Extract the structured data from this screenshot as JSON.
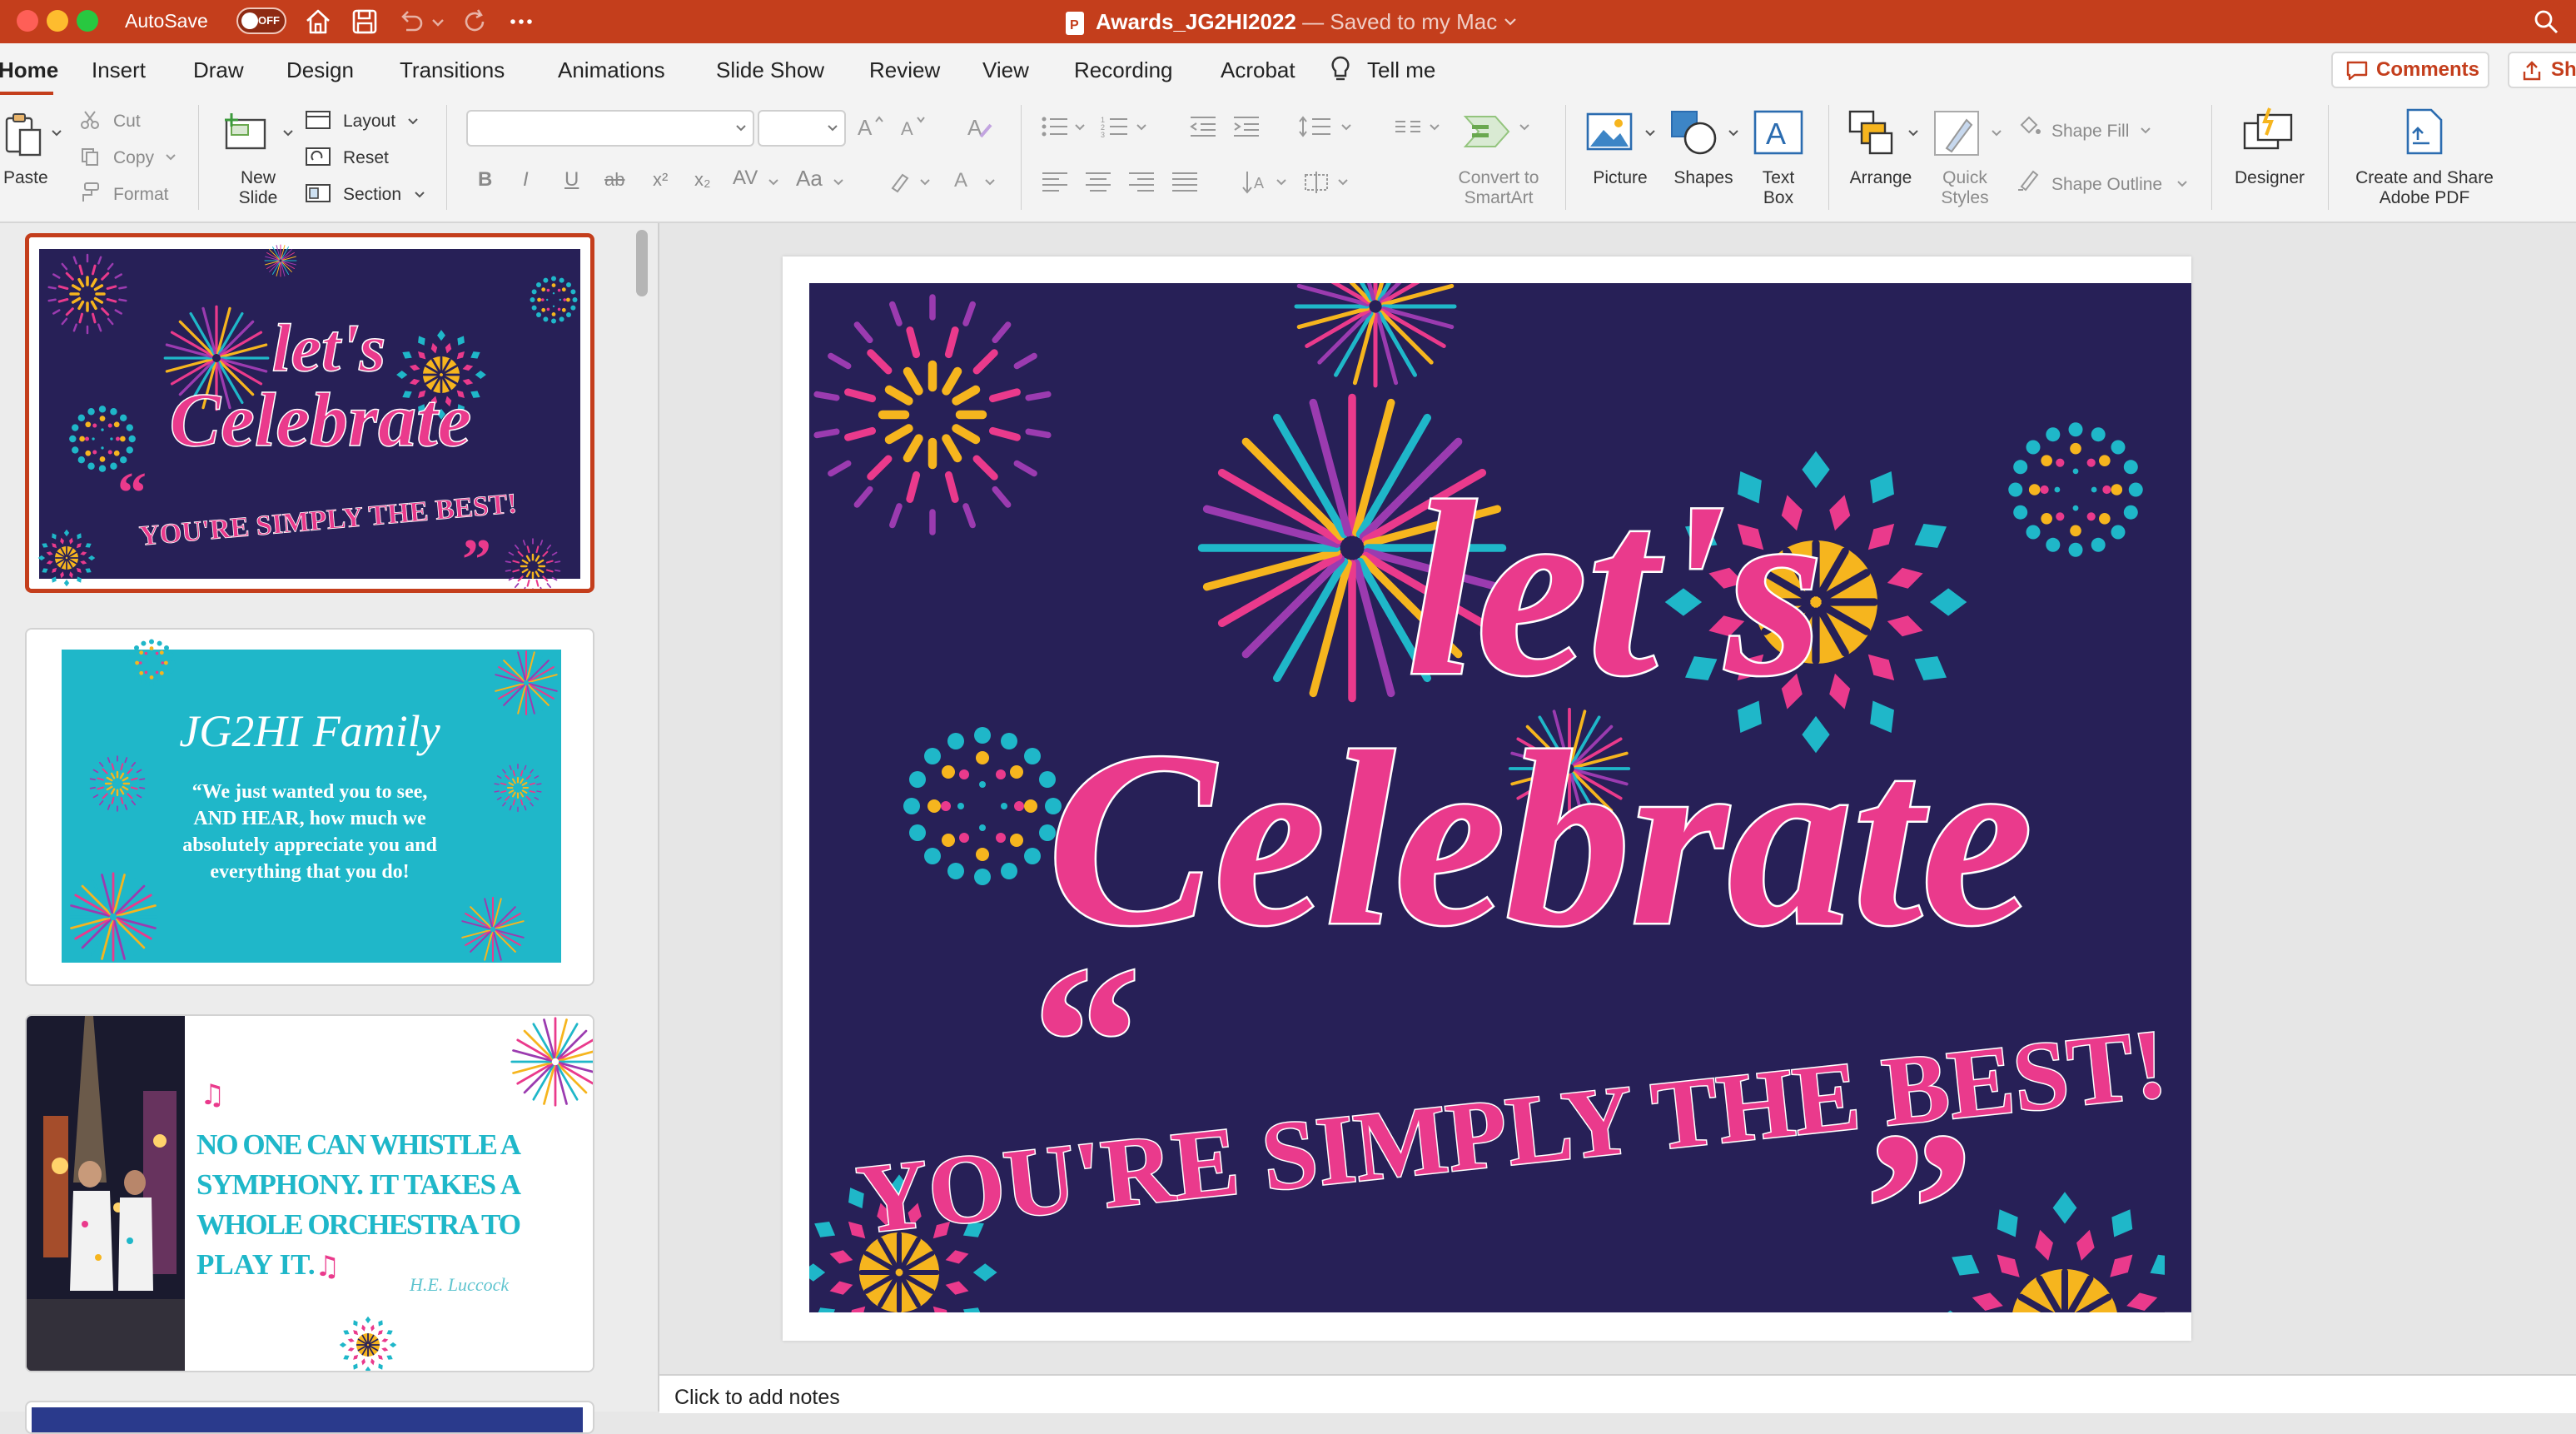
{
  "titlebar": {
    "autosave_label": "AutoSave",
    "autosave_state": "OFF",
    "doc_name": "Awards_JG2HI2022",
    "saved_status": " — Saved to my Mac"
  },
  "tabs": [
    "Home",
    "Insert",
    "Draw",
    "Design",
    "Transitions",
    "Animations",
    "Slide Show",
    "Review",
    "View",
    "Recording",
    "Acrobat",
    "Tell me"
  ],
  "comments_label": "Comments",
  "share_label": "Sh",
  "ribbon": {
    "paste": "Paste",
    "cut": "Cut",
    "copy": "Copy",
    "format": "Format",
    "new_slide_1": "New",
    "new_slide_2": "Slide",
    "layout": "Layout",
    "reset": "Reset",
    "section": "Section",
    "convert_1": "Convert to",
    "convert_2": "SmartArt",
    "picture": "Picture",
    "shapes": "Shapes",
    "textbox_1": "Text",
    "textbox_2": "Box",
    "arrange": "Arrange",
    "quick_1": "Quick",
    "quick_2": "Styles",
    "shape_fill": "Shape Fill",
    "shape_outline": "Shape Outline",
    "designer": "Designer",
    "adobe_1": "Create and Share",
    "adobe_2": "Adobe PDF",
    "font_btns": [
      "B",
      "I",
      "U",
      "ab",
      "x²",
      "x₂",
      "AV",
      "Aa"
    ]
  },
  "slide1": {
    "title_line1": "let's",
    "title_line2": "Celebrate",
    "open_quote": "“",
    "tagline": "YOU'RE SIMPLY THE BEST!",
    "close_quote": "”"
  },
  "slide2": {
    "heading": "JG2HI Family",
    "quote_l1": "“We just wanted you to see,",
    "quote_l2": "AND HEAR, how much we",
    "quote_l3": "absolutely appreciate you and",
    "quote_l4": "everything that you do!"
  },
  "slide3": {
    "l1": "NO ONE CAN WHISTLE A",
    "l2": "SYMPHONY. IT TAKES A",
    "l3": "WHOLE ORCHESTRA TO",
    "l4": "PLAY IT.",
    "signature": "H.E. Luccock"
  },
  "notes_placeholder": "Click to add notes",
  "colors": {
    "accent": "#c43e1c",
    "slide_bg": "#272057",
    "pink": "#ea3a8c",
    "teal": "#1fb7c9",
    "gold": "#f6b51e"
  }
}
